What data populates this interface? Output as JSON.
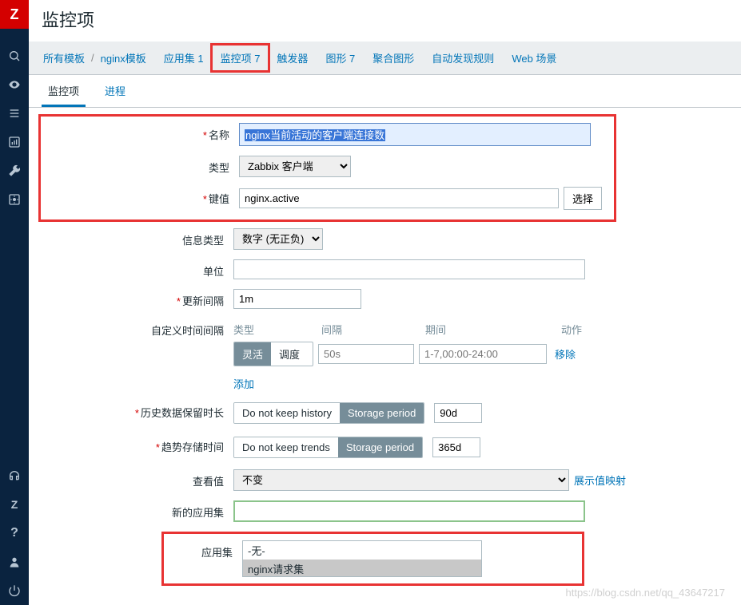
{
  "sidebar": {
    "logo": "Z"
  },
  "page": {
    "title": "监控项"
  },
  "breadcrumb": {
    "all_templates": "所有模板",
    "template_name": "nginx模板",
    "app_sets": "应用集 1",
    "items": "监控项 7",
    "triggers": "触发器",
    "graphs": "图形 7",
    "screens": "聚合图形",
    "discovery": "自动发现规则",
    "web": "Web 场景"
  },
  "tabs": {
    "item": "监控项",
    "process": "进程"
  },
  "form": {
    "name_label": "名称",
    "name_value": "nginx当前活动的客户端连接数",
    "type_label": "类型",
    "type_value": "Zabbix 客户端",
    "key_label": "键值",
    "key_value": "nginx.active",
    "select_btn": "选择",
    "info_type_label": "信息类型",
    "info_type_value": "数字 (无正负)",
    "unit_label": "单位",
    "unit_value": "",
    "update_interval_label": "更新间隔",
    "update_interval_value": "1m",
    "custom_interval_label": "自定义时间间隔",
    "ci_type": "类型",
    "ci_interval": "间隔",
    "ci_period": "期间",
    "ci_action": "动作",
    "ci_flexible": "灵活",
    "ci_scheduling": "调度",
    "ci_delay_placeholder": "50s",
    "ci_period_placeholder": "1-7,00:00-24:00",
    "ci_remove": "移除",
    "ci_add": "添加",
    "history_label": "历史数据保留时长",
    "history_nokeep": "Do not keep history",
    "history_storage": "Storage period",
    "history_value": "90d",
    "trends_label": "趋势存储时间",
    "trends_nokeep": "Do not keep trends",
    "trends_storage": "Storage period",
    "trends_value": "365d",
    "show_value_label": "查看值",
    "show_value_value": "不变",
    "show_value_map": "展示值映射",
    "new_app_label": "新的应用集",
    "new_app_value": "",
    "app_label": "应用集",
    "app_none": "-无-",
    "app_nginx": "nginx请求集"
  },
  "watermark": "https://blog.csdn.net/qq_43647217"
}
